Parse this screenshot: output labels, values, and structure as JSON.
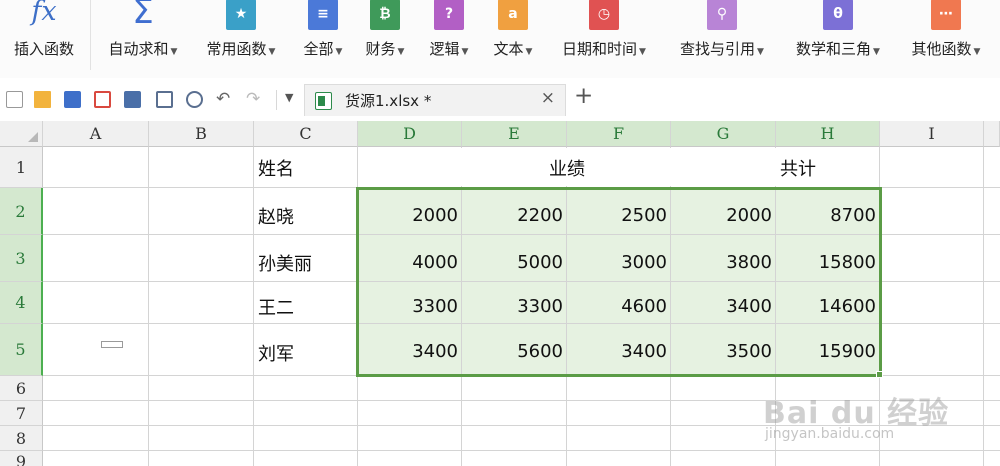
{
  "ribbon": {
    "items": [
      {
        "label": "插入函数",
        "icon": "fx-icon",
        "dropdown": false
      },
      {
        "label": "自动求和",
        "icon": "sigma-icon",
        "dropdown": true
      },
      {
        "label": "常用函数",
        "icon": "star-book-icon",
        "dropdown": true,
        "color": "#3aa0c8",
        "glyph": "★"
      },
      {
        "label": "全部",
        "icon": "list-book-icon",
        "dropdown": true,
        "color": "#4b79d8",
        "glyph": "≡"
      },
      {
        "label": "财务",
        "icon": "finance-book-icon",
        "dropdown": true,
        "color": "#3f9a5a",
        "glyph": "₿"
      },
      {
        "label": "逻辑",
        "icon": "logic-book-icon",
        "dropdown": true,
        "color": "#b25fc5",
        "glyph": "?"
      },
      {
        "label": "文本",
        "icon": "text-book-icon",
        "dropdown": true,
        "color": "#f0a040",
        "glyph": "a"
      },
      {
        "label": "日期和时间",
        "icon": "clock-book-icon",
        "dropdown": true,
        "color": "#e05252",
        "glyph": "◷"
      },
      {
        "label": "查找与引用",
        "icon": "search-book-icon",
        "dropdown": true,
        "color": "#b884d6",
        "glyph": "⚲"
      },
      {
        "label": "数学和三角",
        "icon": "theta-book-icon",
        "dropdown": true,
        "color": "#7c70d6",
        "glyph": "θ"
      },
      {
        "label": "其他函数",
        "icon": "more-book-icon",
        "dropdown": true,
        "color": "#f07850",
        "glyph": "⋯"
      }
    ]
  },
  "toolbar": {
    "icons": [
      "new-file-icon",
      "open-folder-icon",
      "save-icon",
      "export-pdf-icon",
      "print-icon",
      "print-preview-icon",
      "preview-icon",
      "undo-icon",
      "redo-icon",
      "more-dropdown-icon"
    ]
  },
  "tab": {
    "name": "货源1.xlsx *",
    "close": "×",
    "add": "+"
  },
  "sheet": {
    "columns": [
      "A",
      "B",
      "C",
      "D",
      "E",
      "F",
      "G",
      "H",
      "I"
    ],
    "rows": [
      "1",
      "2",
      "3",
      "4",
      "5",
      "6",
      "7",
      "8",
      "9"
    ],
    "header": {
      "name": "姓名",
      "perf": "业绩",
      "total": "共计"
    },
    "data": [
      {
        "name": "赵晓",
        "values": [
          "2000",
          "2200",
          "2500",
          "2000",
          "8700"
        ]
      },
      {
        "name": "孙美丽",
        "values": [
          "4000",
          "5000",
          "3000",
          "3800",
          "15800"
        ]
      },
      {
        "name": "王二",
        "values": [
          "3300",
          "3300",
          "4600",
          "3400",
          "14600"
        ]
      },
      {
        "name": "刘军",
        "values": [
          "3400",
          "5600",
          "3400",
          "3500",
          "15900"
        ]
      }
    ]
  },
  "watermark": {
    "brand": "Bai du 经验",
    "url": "jingyan.baidu.com"
  }
}
